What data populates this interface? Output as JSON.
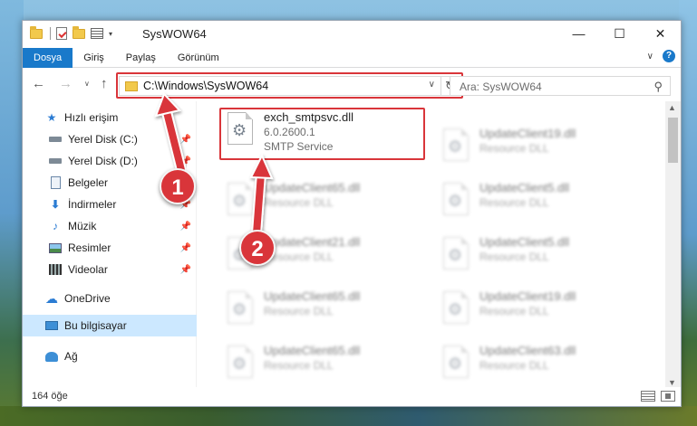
{
  "window": {
    "title": "SysWOW64",
    "controls": {
      "minimize": "—",
      "maximize": "☐",
      "close": "✕"
    }
  },
  "ribbon": {
    "tabs": [
      {
        "label": "Dosya",
        "active": true
      },
      {
        "label": "Giriş"
      },
      {
        "label": "Paylaş"
      },
      {
        "label": "Görünüm"
      }
    ],
    "collapse_glyph": "∨",
    "help_glyph": "?"
  },
  "address": {
    "path": "C:\\Windows\\SysWOW64",
    "dropdown_glyph": "∨",
    "refresh_glyph": "↻"
  },
  "nav_buttons": {
    "back": "←",
    "forward": "→",
    "recent": "∨",
    "up": "↑"
  },
  "search": {
    "placeholder": "Ara: SysWOW64",
    "icon": "search-icon",
    "glyph": "⚲"
  },
  "navpane": {
    "quick_access": "Hızlı erişim",
    "items": [
      {
        "label": "Yerel Disk (C:)",
        "pinned": true,
        "icon": "drive-icon"
      },
      {
        "label": "Yerel Disk (D:)",
        "pinned": true,
        "icon": "drive-icon"
      },
      {
        "label": "Belgeler",
        "pinned": true,
        "icon": "documents-icon"
      },
      {
        "label": "İndirmeler",
        "pinned": true,
        "icon": "downloads-icon"
      },
      {
        "label": "Müzik",
        "pinned": true,
        "icon": "music-icon"
      },
      {
        "label": "Resimler",
        "pinned": true,
        "icon": "pictures-icon"
      },
      {
        "label": "Videolar",
        "pinned": true,
        "icon": "videos-icon"
      }
    ],
    "onedrive": "OneDrive",
    "this_pc": "Bu bilgisayar",
    "network": "Ağ"
  },
  "files": {
    "featured": {
      "name": "exch_smtpsvc.dll",
      "version": "6.0.2600.1",
      "description": "SMTP Service"
    },
    "col1": [
      {
        "name": "UpdateClient65.dll",
        "type": "Resource DLL"
      },
      {
        "name": "UpdateClient21.dll",
        "type": "Resource DLL"
      },
      {
        "name": "UpdateClient65.dll",
        "type": "Resource DLL"
      },
      {
        "name": "UpdateClient65.dll",
        "type": "Resource DLL"
      }
    ],
    "col2": [
      {
        "name": "UpdateClient19.dll",
        "type": "Resource DLL"
      },
      {
        "name": "UpdateClient5.dll",
        "type": "Resource DLL"
      },
      {
        "name": "UpdateClient5.dll",
        "type": "Resource DLL"
      },
      {
        "name": "UpdateClient19.dll",
        "type": "Resource DLL"
      },
      {
        "name": "UpdateClient63.dll",
        "type": "Resource DLL"
      }
    ]
  },
  "status": {
    "item_count": "164 öğe"
  },
  "annotations": {
    "step1": "1",
    "step2": "2",
    "color": "#d9353a"
  }
}
